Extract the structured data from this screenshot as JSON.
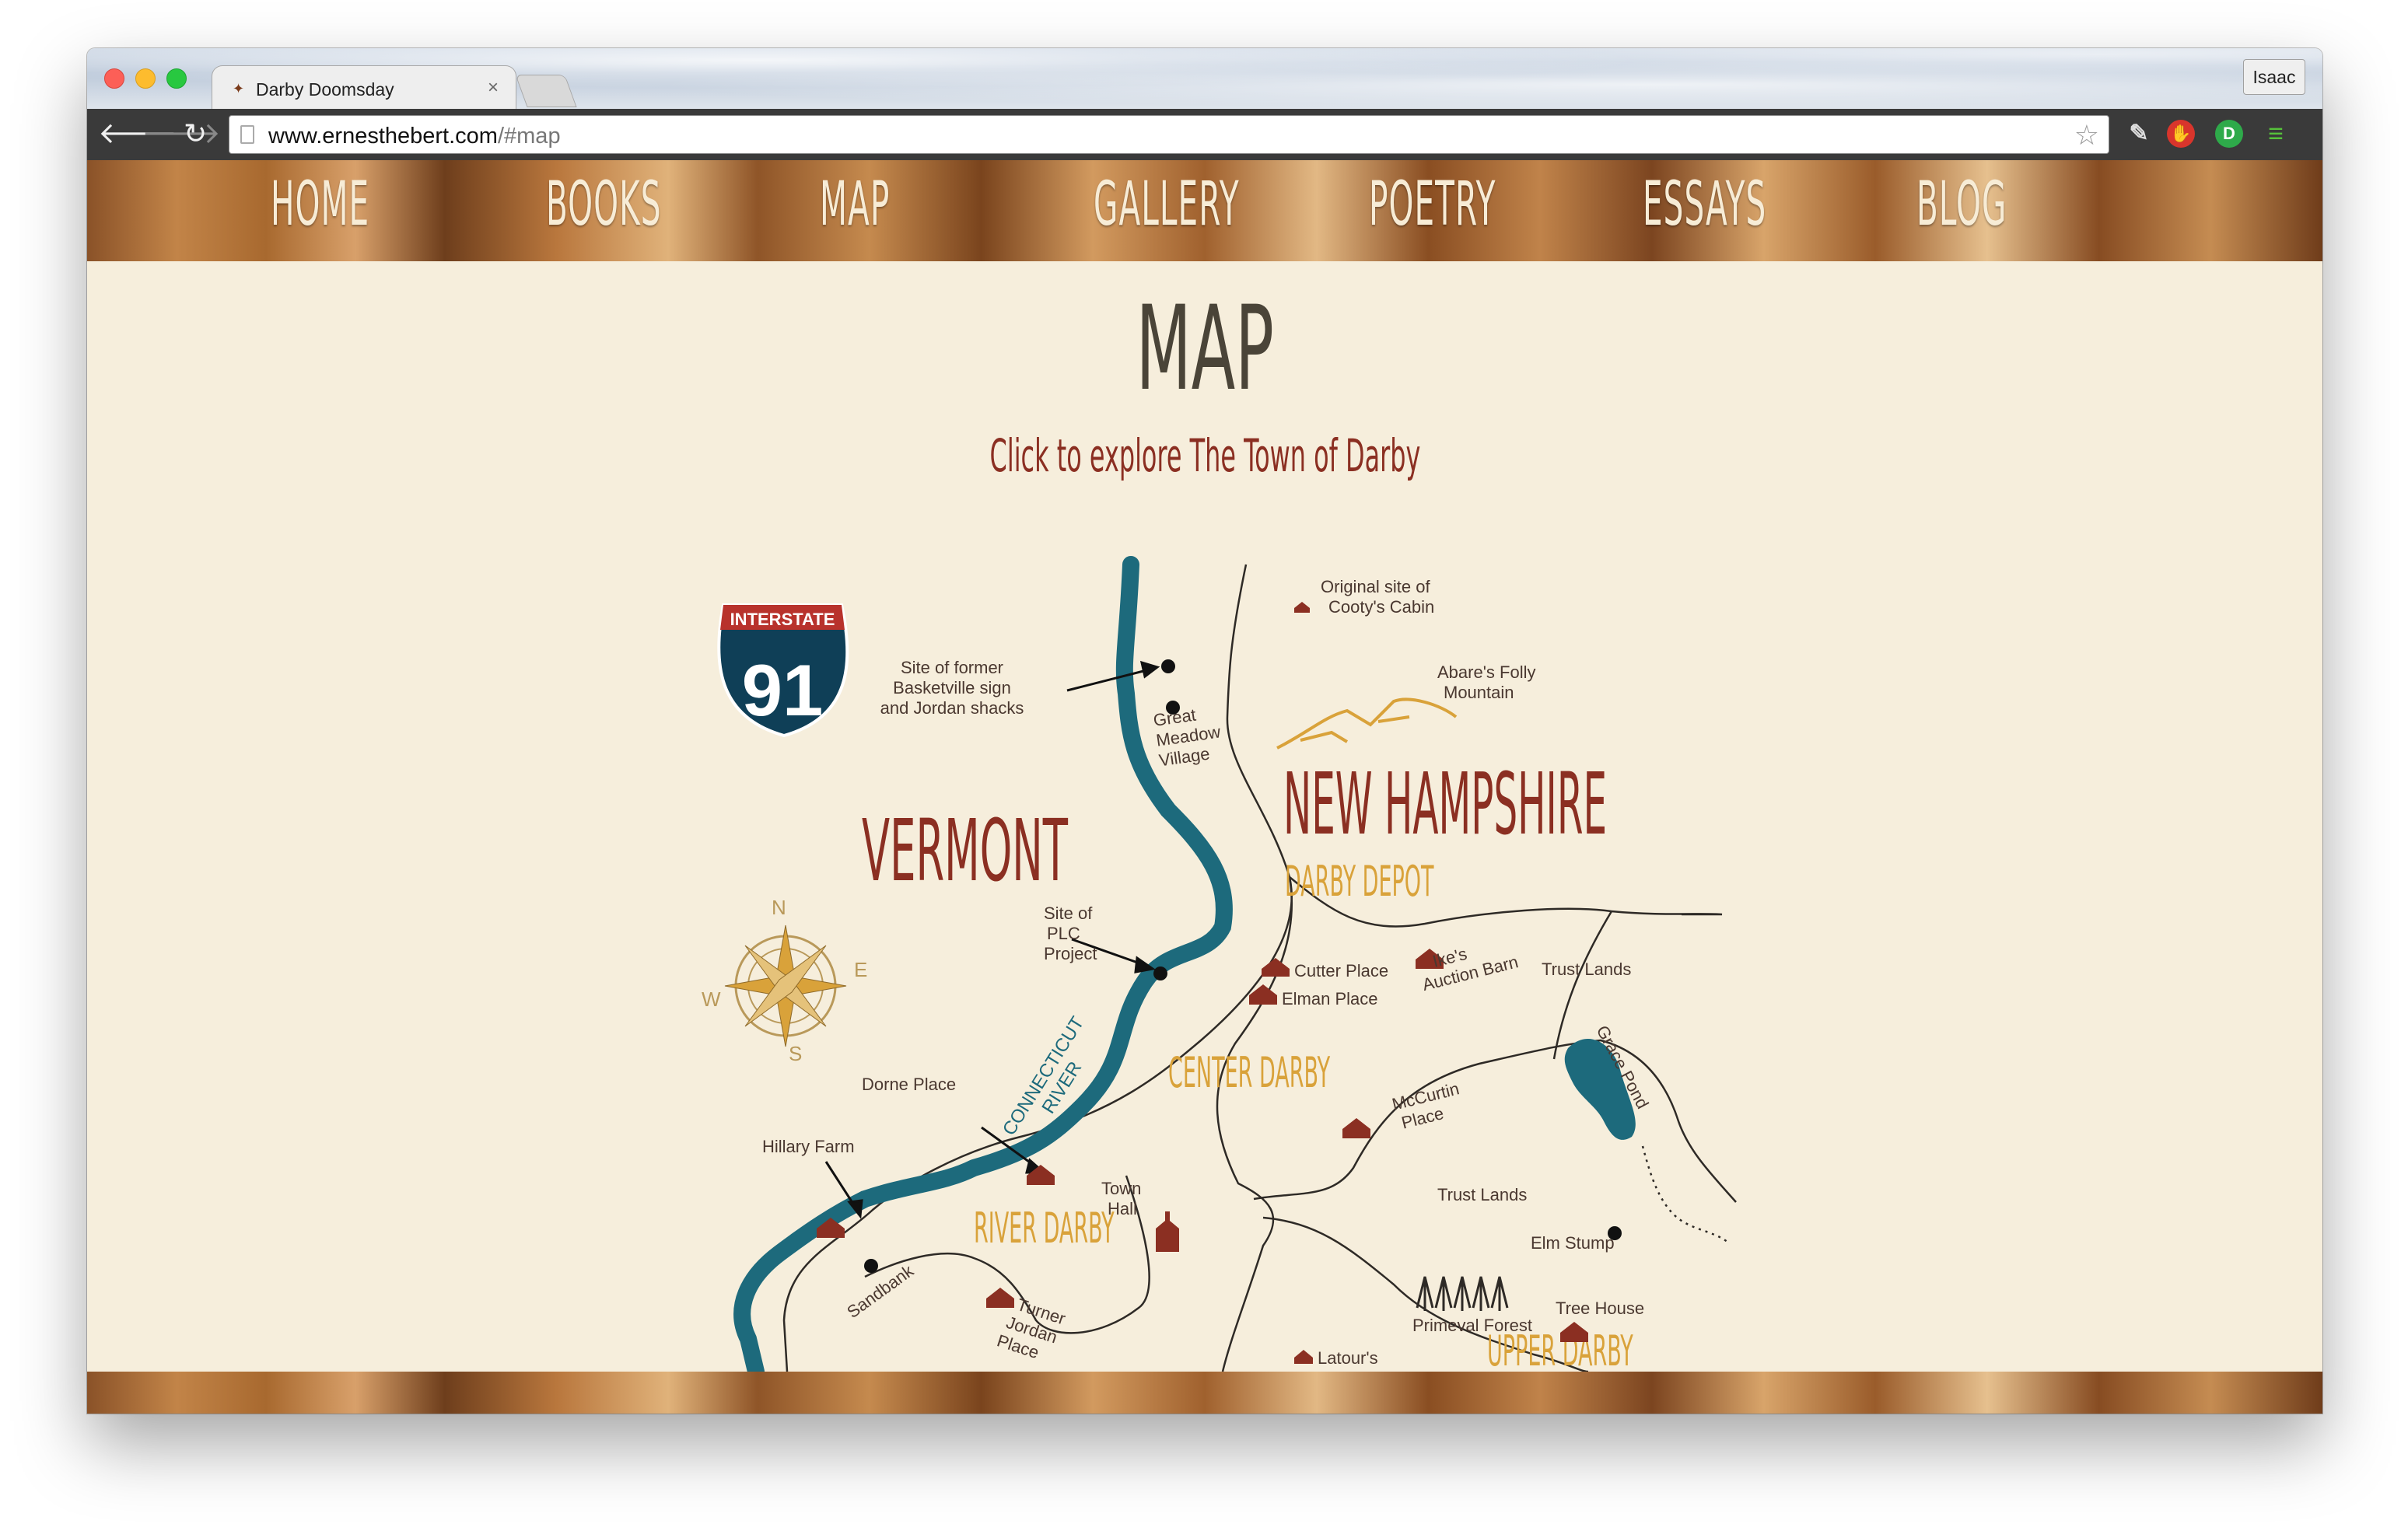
{
  "browser": {
    "tab_title": "Darby Doomsday",
    "tab_close": "×",
    "profile": "Isaac",
    "url_domain": "www.ernesthebert.com",
    "url_path": "/#map"
  },
  "nav": {
    "items": [
      "HOME",
      "BOOKS",
      "MAP",
      "GALLERY",
      "POETRY",
      "ESSAYS",
      "BLOG"
    ]
  },
  "page": {
    "title": "MAP",
    "subtitle": "Click to explore The Town of Darby"
  },
  "map": {
    "interstate_label": "INTERSTATE",
    "interstate_number": "91",
    "compass": {
      "n": "N",
      "e": "E",
      "s": "S",
      "w": "W"
    },
    "state_vermont": "VERMONT",
    "state_nh": "NEW HAMPSHIRE",
    "darby_depot": "DARBY DEPOT",
    "center_darby": "CENTER DARBY",
    "river_darby": "RIVER DARBY",
    "upper_darby": "UPPER DARBY",
    "river": [
      "CONNECTICUT",
      "RIVER"
    ],
    "basketville": [
      "Site of former",
      "Basketville sign",
      "and Jordan shacks"
    ],
    "great_meadow": [
      "Great",
      "Meadow",
      "Village"
    ],
    "plc": [
      "Site of",
      "PLC",
      "Project"
    ],
    "cooty": [
      "Original site of",
      "Cooty's Cabin"
    ],
    "abare": [
      "Abare's Folly",
      "Mountain"
    ],
    "cutter": "Cutter Place",
    "elman": "Elman Place",
    "ike": [
      "Ike's",
      "Auction Barn"
    ],
    "trust_lands": "Trust Lands",
    "grace_pond": "Grace Pond",
    "mccurtin": [
      "McCurtin",
      "Place"
    ],
    "dorne": "Dorne Place",
    "hillary": "Hillary Farm",
    "town_hall": [
      "Town",
      "Hall"
    ],
    "trust_lands_2": "Trust Lands",
    "elm_stump": "Elm Stump",
    "primeval": "Primeval Forest",
    "tree_house": "Tree House",
    "sandbank": "Sandbank",
    "turner": [
      "Turner",
      "Jordan",
      "Place"
    ],
    "latour": "Latour's"
  },
  "colors": {
    "river": "#1d6a7c",
    "maroon": "#8b2f22",
    "gold": "#d9a23a",
    "text": "#4a4438"
  }
}
